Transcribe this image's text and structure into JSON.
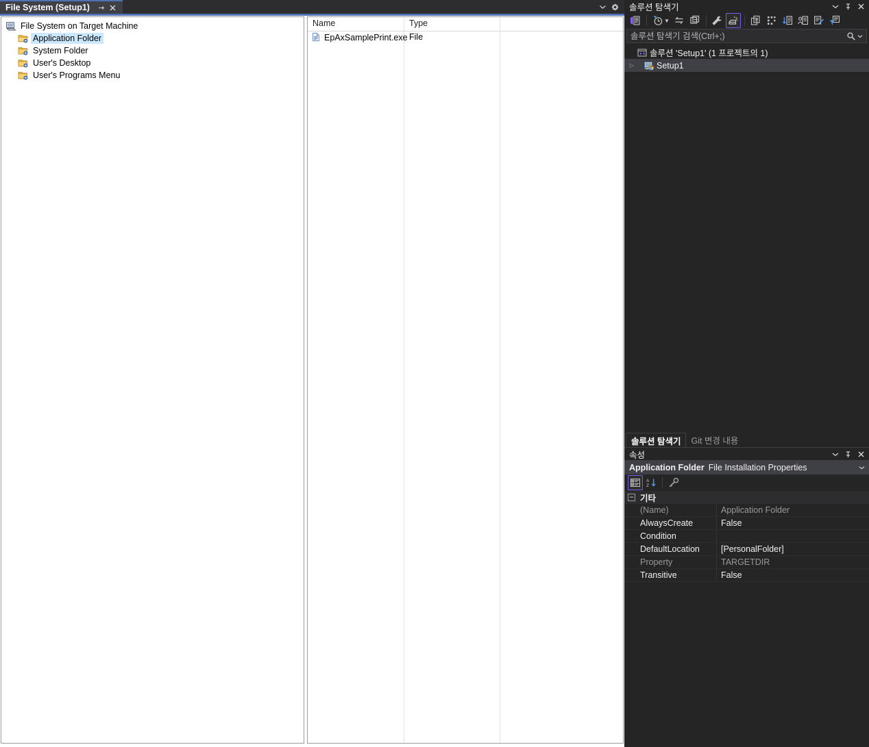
{
  "editor": {
    "tab": {
      "title": "File System (Setup1)",
      "pin_icon": "pin-icon",
      "close_icon": "close-icon"
    },
    "tabstrip_right": {
      "dropdown_icon": "chevron-down-icon",
      "settings_icon": "gear-icon"
    },
    "tree": {
      "root": {
        "label": "File System on Target Machine",
        "icon": "computer-icon"
      },
      "items": [
        {
          "label": "Application Folder",
          "icon": "folder-open-icon",
          "selected": true
        },
        {
          "label": "System Folder",
          "icon": "folder-icon",
          "selected": false
        },
        {
          "label": "User's Desktop",
          "icon": "folder-icon",
          "selected": false
        },
        {
          "label": "User's Programs Menu",
          "icon": "folder-icon",
          "selected": false
        }
      ]
    },
    "list": {
      "columns": [
        "Name",
        "Type"
      ],
      "rows": [
        {
          "name": "EpAxSamplePrint.exe",
          "type": "File",
          "icon": "file-icon"
        }
      ]
    }
  },
  "solution_explorer": {
    "title": "솔루션 탐색기",
    "title_buttons": {
      "dropdown_icon": "chevron-down-icon",
      "pin_icon": "pin-icon",
      "close_icon": "close-icon"
    },
    "toolbar": [
      {
        "name": "code-view-icon",
        "label": "코드 보기"
      },
      {
        "name": "pending-changes-icon",
        "label": "보류 중인 변경 내용 필터"
      },
      {
        "name": "sync-with-active-document-icon",
        "label": "활성 문서와 동기화"
      },
      {
        "name": "refresh-icon",
        "label": "새로 고침"
      },
      {
        "name": "properties-wrench-icon",
        "label": "속성"
      },
      {
        "name": "show-all-files-icon",
        "label": "모든 파일 표시",
        "active": true
      },
      {
        "name": "collapse-all-icon",
        "label": "모두 축소"
      },
      {
        "name": "preview-selected-items-icon",
        "label": "선택한 항목 미리 보기"
      },
      {
        "name": "sort-icon",
        "label": "정렬"
      },
      {
        "name": "person-view-icon",
        "label": "사용자 보기"
      },
      {
        "name": "edit-view-icon",
        "label": "편집"
      },
      {
        "name": "filter-icon",
        "label": "필터"
      }
    ],
    "search": {
      "placeholder": "솔루션 탐색기 검색(Ctrl+;)",
      "value": "",
      "search_icon": "search-icon",
      "dropdown_icon": "chevron-down-icon"
    },
    "tree": [
      {
        "label": "솔루션 'Setup1' (1 프로젝트의 1)",
        "icon": "solution-icon",
        "indent": 0,
        "expander": "",
        "selected": false
      },
      {
        "label": "Setup1",
        "icon": "setup-project-icon",
        "indent": 1,
        "expander": "▷",
        "selected": true
      }
    ],
    "tabs": [
      {
        "label": "솔루션 탐색기",
        "active": true
      },
      {
        "label": "Git 변경 내용",
        "active": false
      }
    ]
  },
  "properties": {
    "title": "속성",
    "title_buttons": {
      "dropdown_icon": "chevron-down-icon",
      "pin_icon": "pin-icon",
      "close_icon": "close-icon"
    },
    "object_name": "Application Folder",
    "object_type": "File Installation Properties",
    "object_dropdown_icon": "chevron-down-icon",
    "toolbar": [
      {
        "name": "categorized-icon",
        "label": "분류별",
        "active": true
      },
      {
        "name": "alphabetical-sort-icon",
        "label": "사전순",
        "active": false
      },
      {
        "name": "property-pages-icon",
        "label": "속성 페이지",
        "active": false
      }
    ],
    "category": {
      "label": "기타",
      "expanded": true,
      "toggle": "−"
    },
    "rows": [
      {
        "name": "(Name)",
        "value": "Application Folder",
        "readonly": true
      },
      {
        "name": "AlwaysCreate",
        "value": "False",
        "readonly": false
      },
      {
        "name": "Condition",
        "value": "",
        "readonly": false
      },
      {
        "name": "DefaultLocation",
        "value": "[PersonalFolder]",
        "readonly": false
      },
      {
        "name": "Property",
        "value": "TARGETDIR",
        "readonly": true
      },
      {
        "name": "Transitive",
        "value": "False",
        "readonly": false
      }
    ]
  },
  "colors": {
    "accent": "#4f72b3",
    "active_toolbar_border": "#7160e8",
    "selection_light": "#cce8ff",
    "selection_dark": "#3f3f46",
    "window_bg": "#252526",
    "editor_bg": "#ffffff"
  }
}
